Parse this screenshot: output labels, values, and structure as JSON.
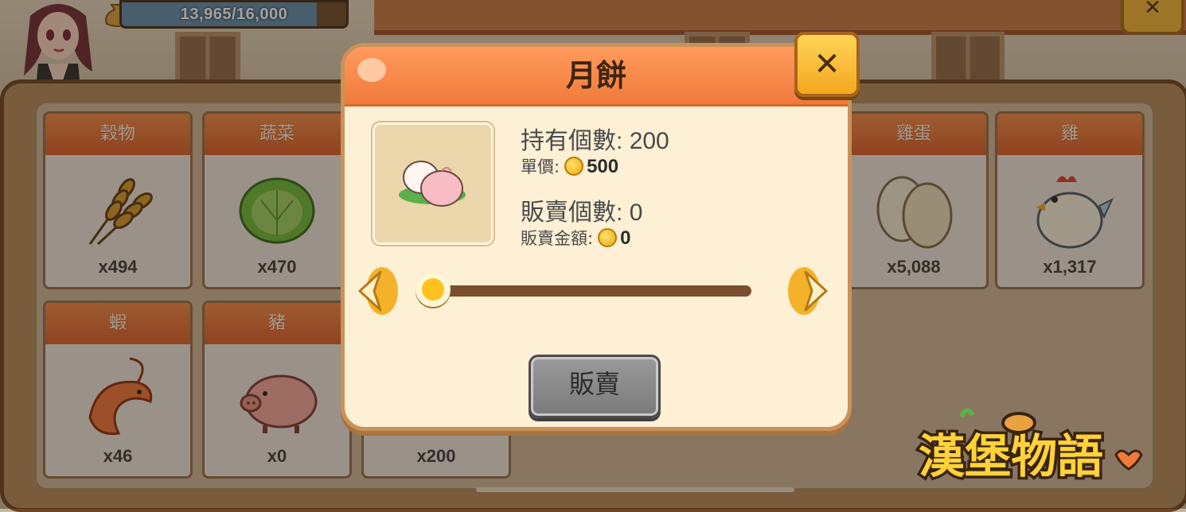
{
  "hud": {
    "resource_text": "13,965/16,000",
    "resource_fill": 0.87
  },
  "inventory": {
    "items": [
      {
        "name": "穀物",
        "count": "x494"
      },
      {
        "name": "蔬菜",
        "count": "x470"
      },
      {
        "name": "雞蛋",
        "count": "x5,088"
      },
      {
        "name": "雞",
        "count": "x1,317"
      },
      {
        "name": "蝦",
        "count": "x46"
      },
      {
        "name": "豬",
        "count": "x0"
      },
      {
        "name": "",
        "count": "x200"
      }
    ]
  },
  "dialog": {
    "title": "月餅",
    "close_label": "✕",
    "owned_label": "持有個數:",
    "owned_value": "200",
    "price_label": "單價:",
    "price_value": "500",
    "sell_count_label": "販賣個數:",
    "sell_count_value": "0",
    "sell_amount_label": "販賣金額:",
    "sell_amount_value": "0",
    "slider_value": 0,
    "sell_button": "販賣"
  },
  "top_close_label": "✕",
  "logo_text": "漢堡物語",
  "colors": {
    "header_orange": "#f07a3a",
    "card_header": "#e66d34",
    "gold": "#f3a81f",
    "panel_brown": "#b38a5a"
  }
}
